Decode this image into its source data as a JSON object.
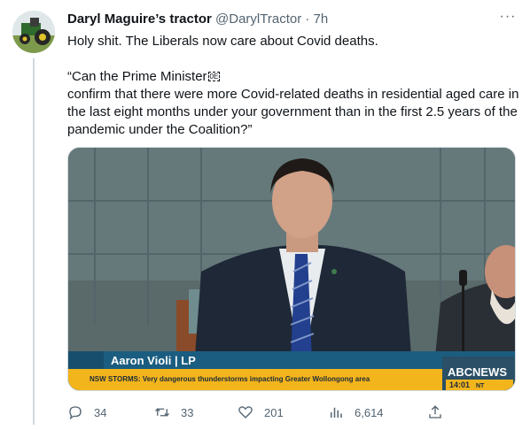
{
  "tweet": {
    "display_name": "Daryl Maguire’s tractor",
    "handle": "@DarylTractor",
    "separator": "·",
    "time": "7h",
    "more_label": "···",
    "text_line1": "Holy shit. The Liberals now care about Covid deaths.",
    "text_line2": "“Can the Prime Minister",
    "text_line2_glyph": "0E",
    "text_line3": "confirm that there were more Covid-related deaths in residential aged care in the last eight months under your government than in the first 2.5 years of the pandemic under the Coalition?”"
  },
  "media": {
    "name_caption": "Aaron Violi | LP",
    "ticker_text": "NSW STORMS: Very dangerous thunderstorms impacting Greater Wollongong area",
    "network_label": "ABC",
    "network_suffix": "NEWS",
    "clock_time": "14:01",
    "clock_zone": "NT",
    "colors": {
      "caption_bar": "#1b5d80",
      "ticker_bar": "#f3b51c",
      "news_box": "#2a4f66",
      "backdrop": "#5a6a6b"
    }
  },
  "actions": {
    "replies": "34",
    "retweets": "33",
    "likes": "201",
    "views": "6,614"
  },
  "colors": {
    "text_primary": "#0f1419",
    "text_secondary": "#536471",
    "divider": "#cfd9de"
  }
}
